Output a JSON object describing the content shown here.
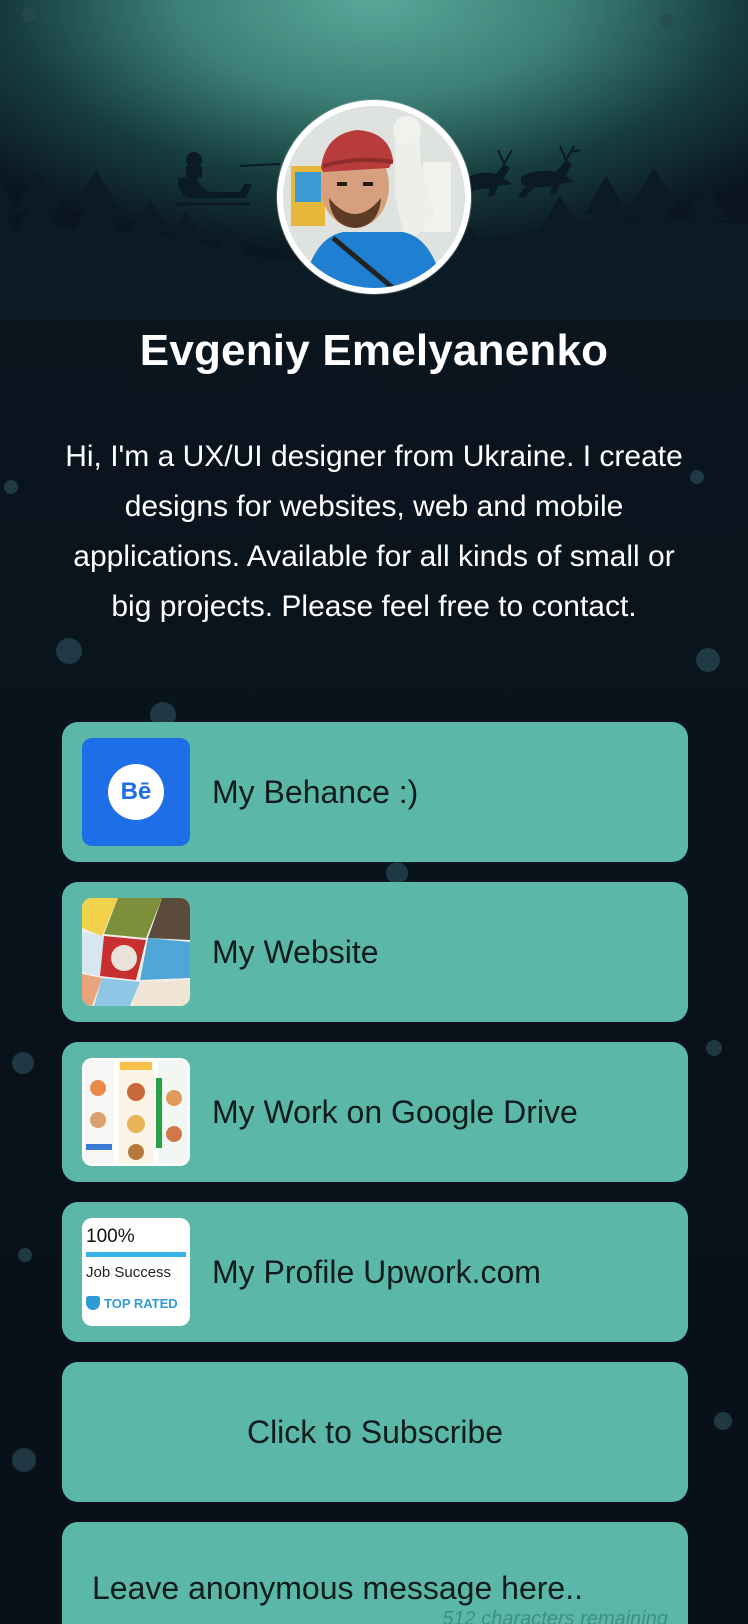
{
  "profile": {
    "name": "Evgeniy Emelyanenko",
    "bio": "Hi, I'm a UX/UI designer from Ukraine. I create designs for websites, web and mobile applications. Available for all kinds of small or big projects. Please feel free to contact.",
    "avatar_alt": "Profile photo"
  },
  "links": [
    {
      "label": "My Behance :)",
      "icon": "behance-icon"
    },
    {
      "label": "My Website",
      "icon": "website-thumbnail"
    },
    {
      "label": "My Work on Google Drive",
      "icon": "google-drive-thumbnail"
    },
    {
      "label": "My Profile Upwork.com",
      "icon": "upwork-thumbnail"
    }
  ],
  "subscribe": {
    "label": "Click to Subscribe"
  },
  "message": {
    "placeholder": "Leave anonymous message here..",
    "chars_remaining": "512 characters remaining"
  },
  "thumbnails": {
    "behance_text": "Bē",
    "upwork_percent": "100%",
    "upwork_job": "Job Success",
    "upwork_rated": "TOP RATED"
  },
  "colors": {
    "background": "#0a1620",
    "card": "#5bb8a8",
    "hero_glow": "#5aa79a",
    "text_light": "#ffffff",
    "text_dark": "#0f1c1c"
  }
}
